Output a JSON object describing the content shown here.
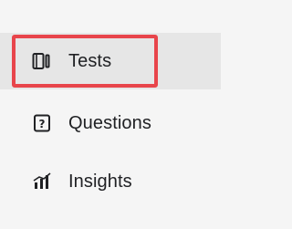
{
  "sidebar": {
    "items": [
      {
        "label": "Tests",
        "icon": "tests-icon",
        "active": true
      },
      {
        "label": "Questions",
        "icon": "questions-icon",
        "active": false
      },
      {
        "label": "Insights",
        "icon": "insights-icon",
        "active": false
      }
    ]
  },
  "colors": {
    "background": "#f5f5f5",
    "active_background": "#e6e6e6",
    "text": "#202124",
    "highlight_border": "#e8454b"
  }
}
